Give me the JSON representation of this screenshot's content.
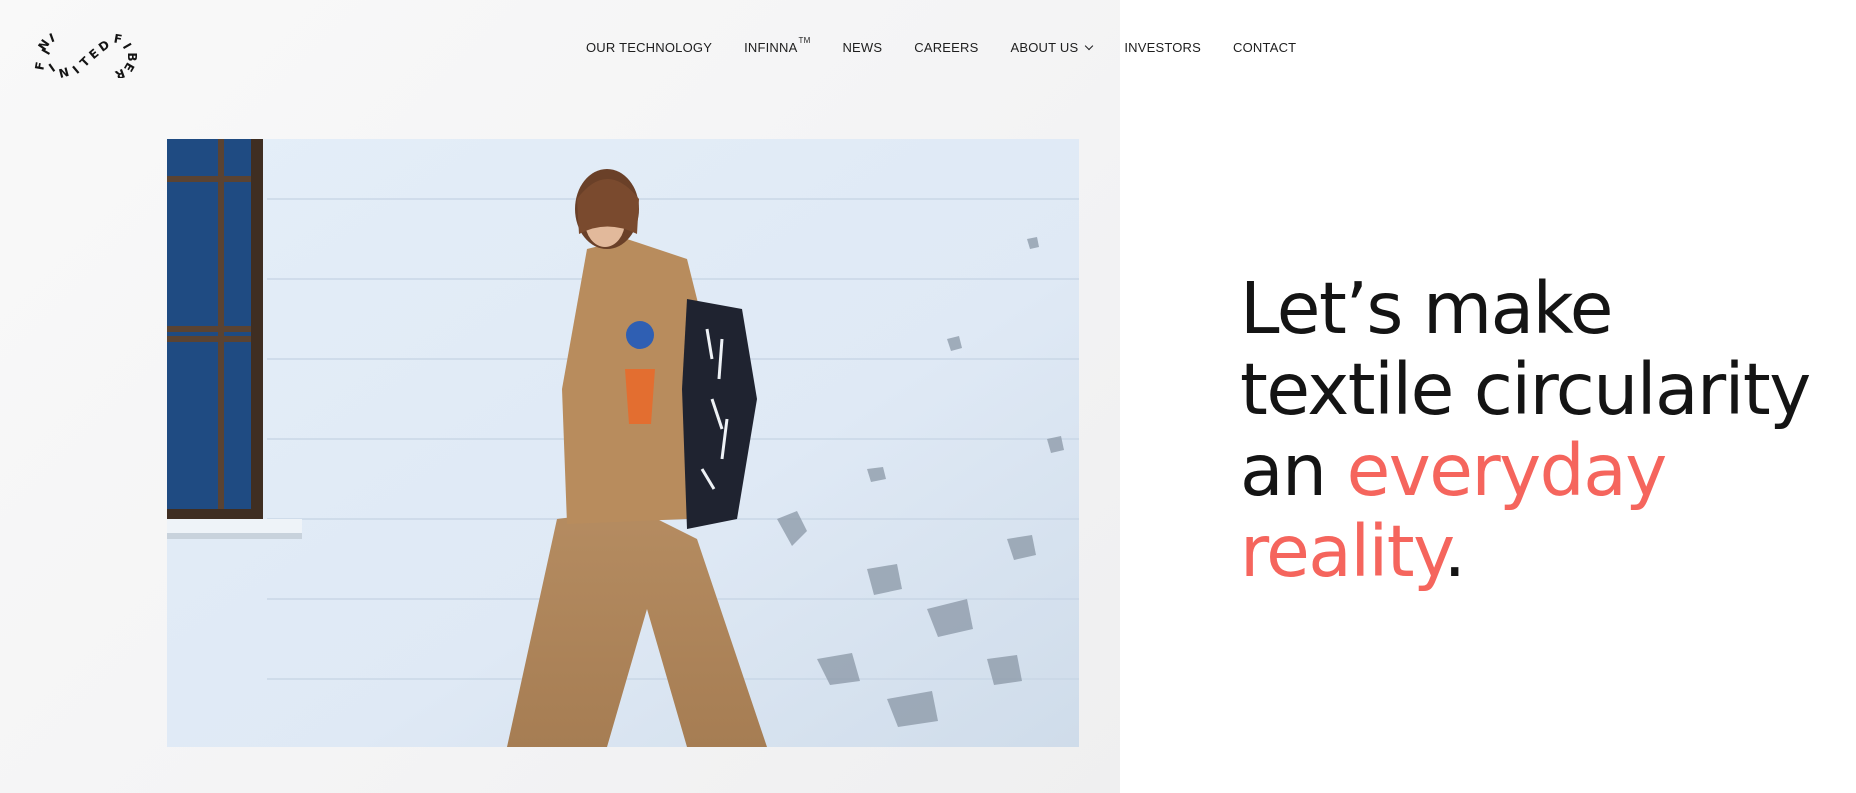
{
  "brand": {
    "logo_text": "INFINITEDFIBER",
    "logo_icon": "circular-wordmark-logo"
  },
  "nav": {
    "items": [
      {
        "label": "OUR TECHNOLOGY"
      },
      {
        "label": "INFINNA",
        "sup": "TM"
      },
      {
        "label": "NEWS"
      },
      {
        "label": "CAREERS"
      },
      {
        "label": "ABOUT US",
        "icon": "chevron-down-icon"
      },
      {
        "label": "INVESTORS"
      },
      {
        "label": "CONTACT"
      }
    ]
  },
  "hero": {
    "image": "model-in-tan-jacket-against-painted-brick-wall",
    "headline": {
      "line1": "Let’s make",
      "line2": "textile circularity",
      "line3_prefix": "an ",
      "accent_1": "everyday",
      "accent_2": "reality",
      "suffix": "."
    }
  },
  "colors": {
    "accent": "#f5655d",
    "text": "#141414",
    "panel": "#f6f6f7"
  }
}
